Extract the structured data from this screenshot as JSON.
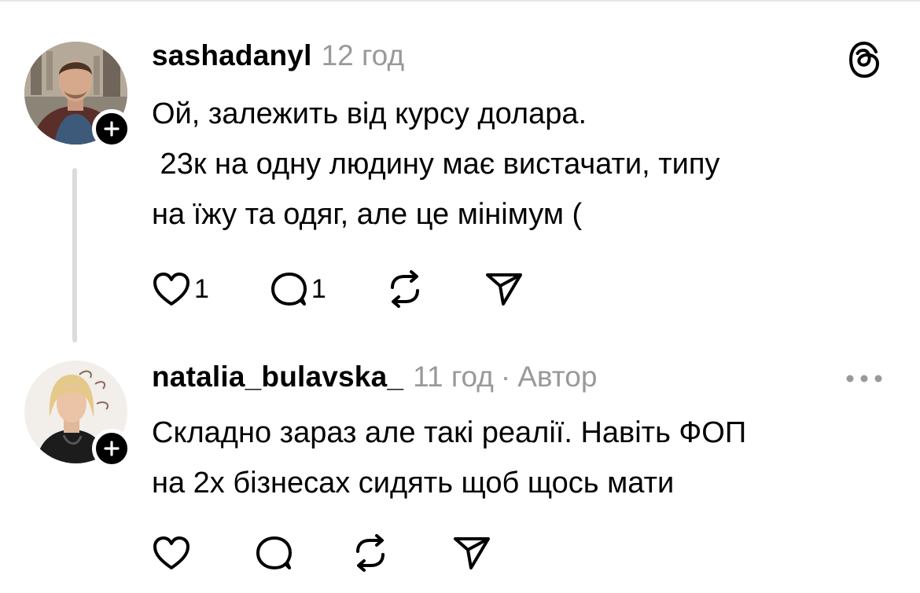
{
  "comments": [
    {
      "username": "sashadanyl",
      "time": "12 год",
      "body_lines": [
        "Ой, залежить від курсу долара.",
        " 23к на одну людину має вистачати, типу",
        "на їжу та одяг, але це мінімум ("
      ],
      "like_count": "1",
      "reply_count": "1",
      "corner_icon": "threads-logo-icon"
    },
    {
      "username": "natalia_bulavska_",
      "time": "11 год",
      "separator": "·",
      "role": "Автор",
      "body_lines": [
        "Складно зараз але такі реалії. Навіть ФОП",
        "на 2х бізнесах сидять щоб щось мати"
      ],
      "corner_icon": "more-options-icon"
    }
  ],
  "icons": [
    "heart-icon",
    "comment-icon",
    "repost-icon",
    "share-icon",
    "follow-plus-icon"
  ],
  "colors": {
    "text": "#000000",
    "muted": "#999999",
    "thread_line": "#dcdcdc",
    "badge": "#000000"
  }
}
